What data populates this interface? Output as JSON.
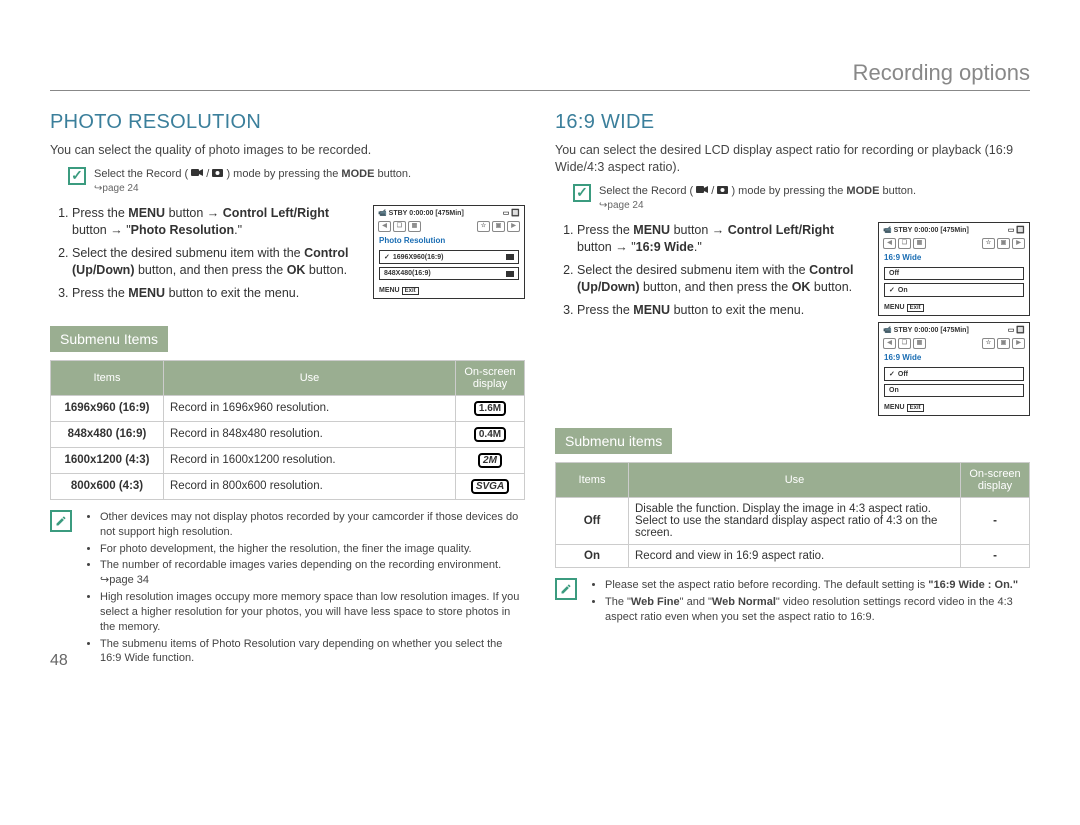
{
  "page_number": "48",
  "header": "Recording options",
  "left": {
    "title": "PHOTO RESOLUTION",
    "intro": "You can select the quality of photo images to be recorded.",
    "mode_note_pre": "Select the Record (",
    "mode_note_post": ") mode by pressing the ",
    "mode_bold": "MODE",
    "mode_note_end": " button.",
    "page_ref": "↪page 24",
    "steps": {
      "s1a": "Press the ",
      "s1_menu": "MENU",
      "s1b": " button → ",
      "s1_control": "Control Left/Right",
      "s1c": " button → \"",
      "s1_photo": "Photo Resolution",
      "s1d": ".\"",
      "s2a": "Select the desired submenu item with the ",
      "s2_cud": "Control (Up/Down)",
      "s2b": " button, and then press the ",
      "s2_ok": "OK",
      "s2c": " button.",
      "s3a": "Press the ",
      "s3_menu": "MENU",
      "s3b": " button to exit the menu."
    },
    "screen": {
      "stby": "STBY",
      "time": "0:00:00",
      "remain": "[475Min]",
      "menu_title": "Photo Resolution",
      "item1": "1696X960(16:9)",
      "item2": "848X480(16:9)",
      "foot_menu": "MENU",
      "foot_exit": "Exit"
    },
    "submenu_head": "Submenu Items",
    "table_headers": {
      "h1": "Items",
      "h2": "Use",
      "h3": "On-screen display"
    },
    "table": [
      {
        "items": "1696x960 (16:9)",
        "use": "Record in 1696x960 resolution.",
        "icon": "1.6M"
      },
      {
        "items": "848x480 (16:9)",
        "use": "Record in 848x480 resolution.",
        "icon": "0.4M"
      },
      {
        "items": "1600x1200 (4:3)",
        "use": "Record in 1600x1200 resolution.",
        "icon": "2M"
      },
      {
        "items": "800x600 (4:3)",
        "use": "Record in 800x600 resolution.",
        "icon": "SVGA"
      }
    ],
    "tips": [
      "Other devices may not display photos recorded by your camcorder if those devices do not support high resolution.",
      "For photo development, the higher the resolution, the finer the image quality.",
      "The number of recordable images varies depending on the recording environment. ↪page 34",
      "High resolution images occupy more memory space than low resolution images. If you select a higher resolution for your photos, you will have less space to store photos in the memory.",
      "The submenu items of Photo Resolution vary depending on whether you select the 16:9 Wide function."
    ]
  },
  "right": {
    "title": "16:9 WIDE",
    "intro": "You can select the desired LCD display aspect ratio for recording or playback (16:9 Wide/4:3 aspect ratio).",
    "mode_note_pre": "Select the Record (",
    "mode_note_post": ") mode by pressing the ",
    "mode_bold": "MODE",
    "mode_note_end": " button.",
    "page_ref": "↪page 24",
    "steps": {
      "s1a": "Press the ",
      "s1_menu": "MENU",
      "s1b": " button → ",
      "s1_control": "Control Left/Right",
      "s1c": " button → \"",
      "s1_wide": "16:9 Wide",
      "s1d": ".\"",
      "s2a": "Select the desired submenu item with the ",
      "s2_cud": "Control (Up/Down)",
      "s2b": " button, and then press the ",
      "s2_ok": "OK",
      "s2c": " button.",
      "s3a": "Press the ",
      "s3_menu": "MENU",
      "s3b": " button to exit the menu."
    },
    "screen1": {
      "stby": "STBY",
      "time": "0:00:00",
      "remain": "[475Min]",
      "menu_title": "16:9 Wide",
      "item1": "Off",
      "item2": "On",
      "foot_menu": "MENU",
      "foot_exit": "Exit"
    },
    "screen2": {
      "stby": "STBY",
      "time": "0:00:00",
      "remain": "[475Min]",
      "menu_title": "16:9 Wide",
      "item1": "Off",
      "item2": "On",
      "foot_menu": "MENU",
      "foot_exit": "Exit"
    },
    "submenu_head": "Submenu items",
    "table_headers": {
      "h1": "Items",
      "h2": "Use",
      "h3": "On-screen display"
    },
    "table": [
      {
        "items": "Off",
        "use": "Disable the function. Display the image in 4:3 aspect ratio.\nSelect to use the standard display aspect ratio of 4:3 on the screen.",
        "icon": "-"
      },
      {
        "items": "On",
        "use": "Record and view in 16:9 aspect ratio.",
        "icon": "-"
      }
    ],
    "tips_pre": "Please set the aspect ratio before recording. The default setting is ",
    "tips_bold": "\"16:9 Wide : On.\"",
    "tip2_a": "The \"",
    "tip2_b": "Web Fine",
    "tip2_c": "\" and \"",
    "tip2_d": "Web Normal",
    "tip2_e": "\" video resolution settings record video in the 4:3 aspect ratio even when you set the aspect ratio to 16:9."
  }
}
